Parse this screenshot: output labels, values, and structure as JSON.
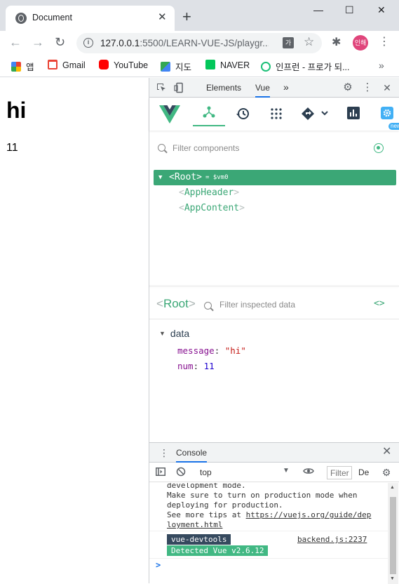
{
  "browser": {
    "tab_title": "Document",
    "tab_close": "✕",
    "new_tab": "+",
    "window_controls": {
      "minimize": "—",
      "maximize": "☐",
      "close": "✕"
    },
    "nav": {
      "back": "←",
      "forward": "→",
      "reload": "↻"
    },
    "url": "127.0.0.1",
    "url_rest": ":5500/LEARN-VUE-JS/playgr...",
    "info_icon": "i",
    "translate_label": "가",
    "star": "☆",
    "extensions": "✱",
    "profile": "인해",
    "menu": "⋮"
  },
  "bookmarks": {
    "items": [
      {
        "label": "앱",
        "icon": "apps-grid-icon",
        "color": "#ea4335"
      },
      {
        "label": "Gmail",
        "icon": "gmail-icon",
        "color": "#ea4335"
      },
      {
        "label": "YouTube",
        "icon": "youtube-icon",
        "color": "#ff0000"
      },
      {
        "label": "지도",
        "icon": "maps-icon",
        "color": "#34a853"
      },
      {
        "label": "NAVER",
        "icon": "naver-icon",
        "color": "#03c75a"
      },
      {
        "label": "인프런 - 프로가 되...",
        "icon": "inflearn-icon",
        "color": "#1dc078"
      }
    ],
    "more": "»"
  },
  "page": {
    "heading": "hi",
    "value": "11"
  },
  "devtools": {
    "tabs": {
      "elements": "Elements",
      "vue": "Vue",
      "more": "»"
    },
    "settings": "⚙",
    "kebab": "⋮",
    "close": "✕",
    "vue": {
      "new_badge": "new",
      "filter_placeholder": "Filter components",
      "tree": {
        "root": "<Root>",
        "root_arrow": "▼",
        "root_ref": "= $vm0",
        "children": [
          "AppHeader",
          "AppContent"
        ]
      },
      "inspected": {
        "name": "Root",
        "filter_placeholder": "Filter inspected data",
        "code_toggle": "<>",
        "section": "data",
        "props": [
          {
            "key": "message",
            "value": "\"hi\"",
            "type": "string"
          },
          {
            "key": "num",
            "value": "11",
            "type": "number"
          }
        ]
      }
    },
    "console": {
      "tab": "Console",
      "context": "top",
      "filter_placeholder": "Filter",
      "levels": "De",
      "log_lines": [
        "development mode.",
        "Make sure to turn on production mode when",
        "deploying for production.",
        "See more tips at "
      ],
      "link_part1": "https://vuejs.org/guide/dep",
      "link_part2": "loyment.html",
      "devtools_badge": "vue-devtools",
      "detected_badge": "Detected Vue v2.6.12",
      "source": "backend.js:2237",
      "prompt": ">"
    }
  }
}
